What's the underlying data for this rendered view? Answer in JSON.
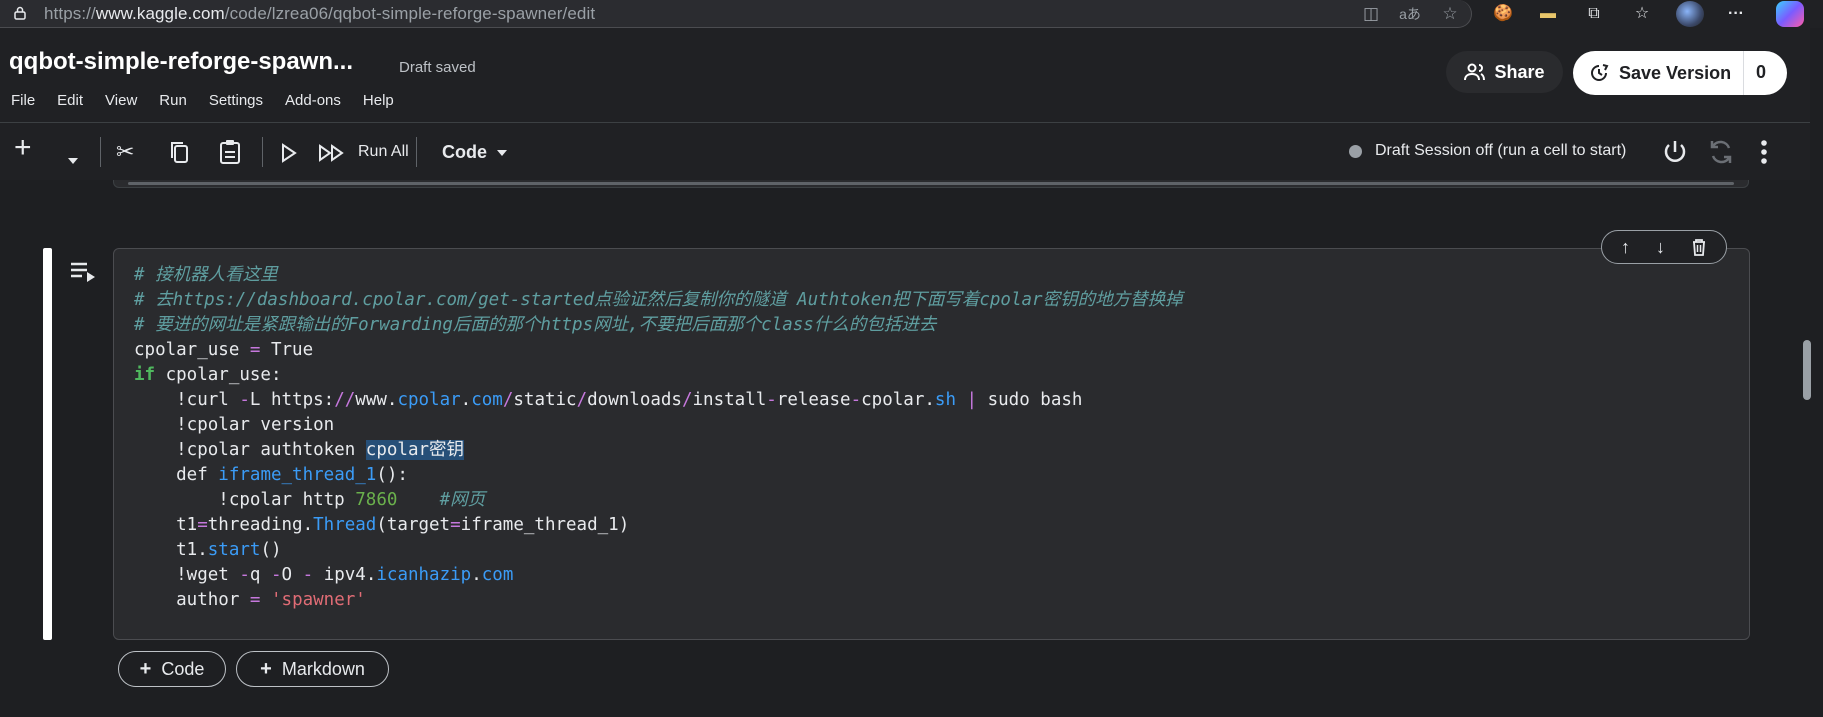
{
  "browser": {
    "url_prefix": "https://",
    "url_host": "www.kaggle.com",
    "url_path": "/code/lzrea06/qqbot-simple-reforge-spawner/edit"
  },
  "header": {
    "title": "qqbot-simple-reforge-spawn...",
    "status": "Draft saved",
    "menu": [
      "File",
      "Edit",
      "View",
      "Run",
      "Settings",
      "Add-ons",
      "Help"
    ],
    "share_label": "Share",
    "save_label": "Save Version",
    "save_count": "0"
  },
  "toolbar": {
    "run_all_label": "Run All",
    "cell_type": "Code",
    "session_status": "Draft Session off (run a cell to start)"
  },
  "cell": {
    "lines": [
      "# 接机器人看这里",
      "# 去https://dashboard.cpolar.com/get-started点验证然后复制你的隧道 Authtoken把下面写着cpolar密钥的地方替换掉",
      "# 要进的网址是紧跟输出的Forwarding后面的那个https网址,不要把后面那个class什么的包括进去",
      "cpolar_use = True",
      "if cpolar_use:",
      "    !curl -L https://www.cpolar.com/static/downloads/install-release-cpolar.sh | sudo bash",
      "    !cpolar version",
      "    !cpolar authtoken cpolar密钥",
      "    def iframe_thread_1():",
      "        !cpolar http 7860    #网页",
      "    t1=threading.Thread(target=iframe_thread_1)",
      "    t1.start()",
      "    !wget -q -O - ipv4.icanhazip.com",
      "    author = 'spawner'"
    ]
  },
  "add_cell": {
    "code_label": "Code",
    "markdown_label": "Markdown"
  },
  "colors": {
    "accent_white": "#ffffff",
    "comment": "#5f9ea0",
    "keyword": "#4fb85e",
    "string": "#e06c75",
    "attribute": "#3b9cf7"
  }
}
